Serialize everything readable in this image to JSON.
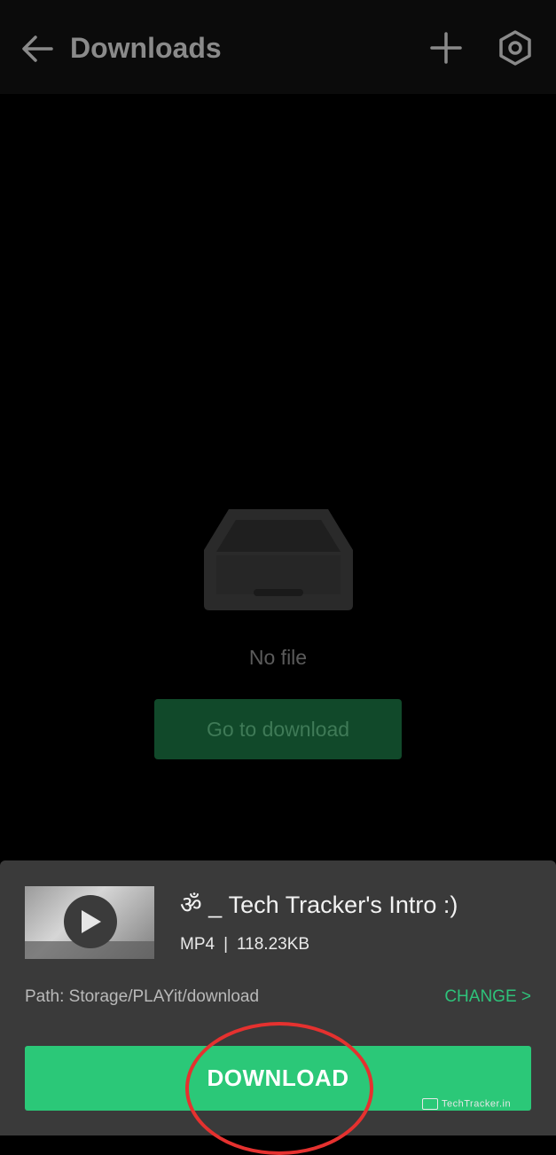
{
  "app_bar": {
    "title": "Downloads",
    "back_icon": "arrow-left-icon",
    "add_icon": "plus-icon",
    "settings_icon": "gear-icon"
  },
  "empty_state": {
    "icon": "empty-tray-icon",
    "message": "No file",
    "button_label": "Go to download"
  },
  "download_sheet": {
    "file_name": "ॐ _ Tech Tracker's Intro :)",
    "format": "MP4",
    "separator": "|",
    "size": "118.23KB",
    "path": "Path: Storage/PLAYit/download",
    "change_label": "CHANGE >",
    "download_label": "DOWNLOAD"
  },
  "watermark": "TechTracker.in",
  "colors": {
    "accent": "#2bc878",
    "sheet_bg": "#3a3a3a",
    "annotation_circle": "#e5312f"
  }
}
